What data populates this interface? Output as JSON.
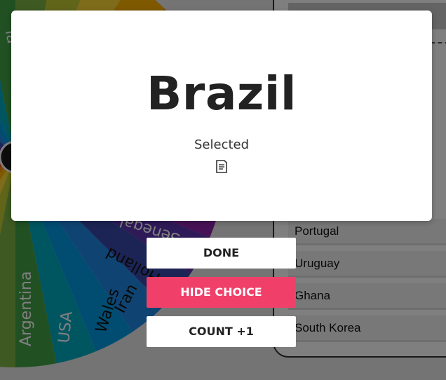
{
  "modal": {
    "title": "Brazil",
    "subtitle": "Selected",
    "note_icon": "notes-icon"
  },
  "actions": {
    "done": "DONE",
    "hide_choice": "HIDE CHOICE",
    "count": "COUNT +1"
  },
  "wheel": {
    "labels": [
      "Argentina",
      "USA",
      "Wales",
      "Iran",
      "Holland",
      "Senegal"
    ],
    "partial_labels": [
      "ia",
      "p"
    ]
  },
  "side_panel": {
    "entries": [
      "Portugal",
      "Uruguay",
      "Ghana",
      "South Korea"
    ]
  },
  "colors": {
    "accent": "#f0406a",
    "overlay": "rgba(0,0,0,0.5)"
  }
}
